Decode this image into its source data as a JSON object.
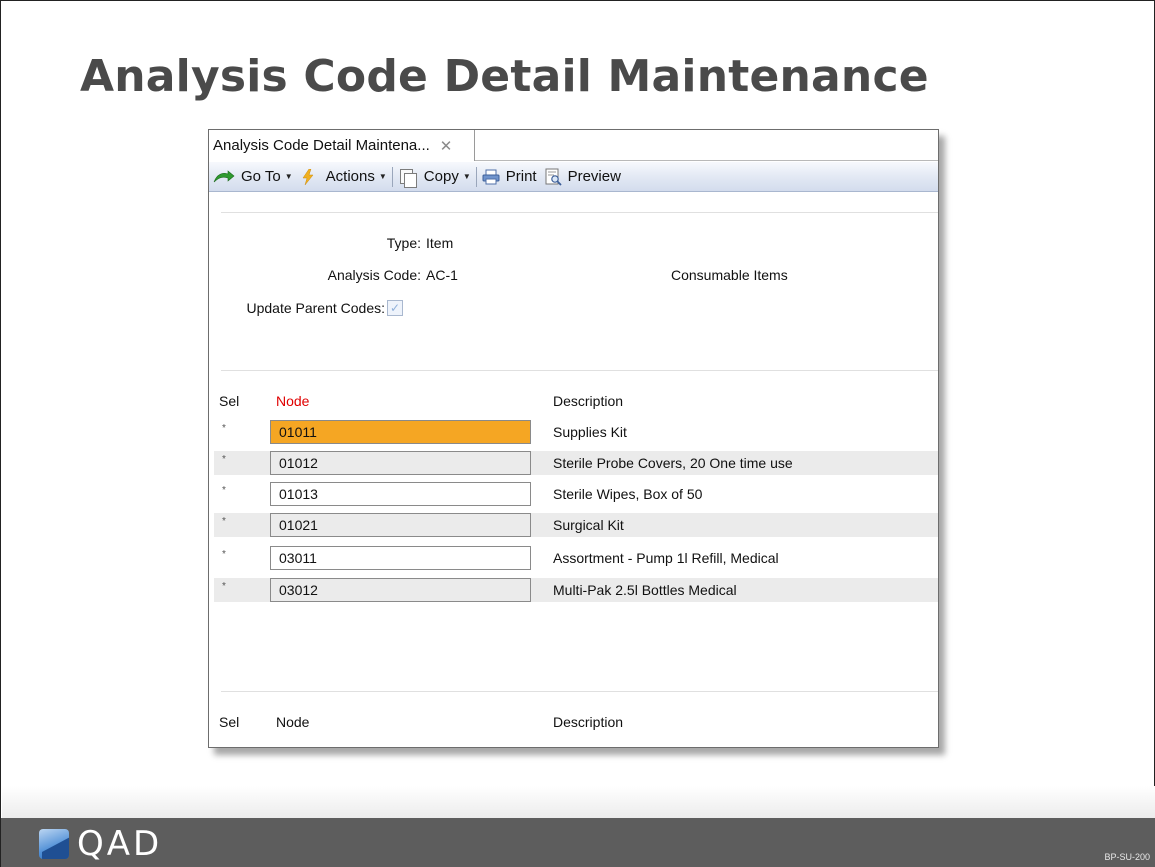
{
  "slide": {
    "title": "Analysis Code Detail Maintenance",
    "footer_brand": "QAD",
    "footer_code": "BP-SU-200"
  },
  "window": {
    "tab_label": "Analysis Code Detail Maintena...",
    "toolbar": {
      "goto_label": "Go To",
      "actions_label": "Actions",
      "copy_label": "Copy",
      "print_label": "Print",
      "preview_label": "Preview"
    },
    "form": {
      "type_label": "Type:",
      "type_value": "Item",
      "analysis_code_label": "Analysis Code:",
      "analysis_code_value": "AC-1",
      "analysis_code_description": "Consumable Items",
      "update_parent_label": "Update Parent Codes:",
      "update_parent_checked": true
    },
    "grid": {
      "headers": {
        "sel": "Sel",
        "node": "Node",
        "description": "Description"
      },
      "rows": [
        {
          "sel": "*",
          "node": "01011",
          "description": "Supplies Kit"
        },
        {
          "sel": "*",
          "node": "01012",
          "description": "Sterile Probe Covers, 20 One time use"
        },
        {
          "sel": "*",
          "node": "01013",
          "description": "Sterile Wipes, Box of 50"
        },
        {
          "sel": "*",
          "node": "01021",
          "description": "Surgical Kit"
        },
        {
          "sel": "*",
          "node": "03011",
          "description": "Assortment - Pump 1l Refill, Medical"
        },
        {
          "sel": "*",
          "node": "03012",
          "description": "Multi-Pak 2.5l Bottles Medical"
        }
      ]
    },
    "bottom_grid": {
      "headers": {
        "sel": "Sel",
        "node": "Node",
        "description": "Description"
      }
    }
  },
  "colors": {
    "title_text": "#4a4a4a",
    "active_cell": "#f5a623",
    "required_header": "#e00000",
    "footer_bar": "#5d5d5d"
  },
  "icons": [
    "goto-arrow-icon",
    "lightning-icon",
    "copy-icon",
    "printer-icon",
    "preview-icon",
    "close-icon",
    "checkmark-icon",
    "qad-logo-icon"
  ]
}
